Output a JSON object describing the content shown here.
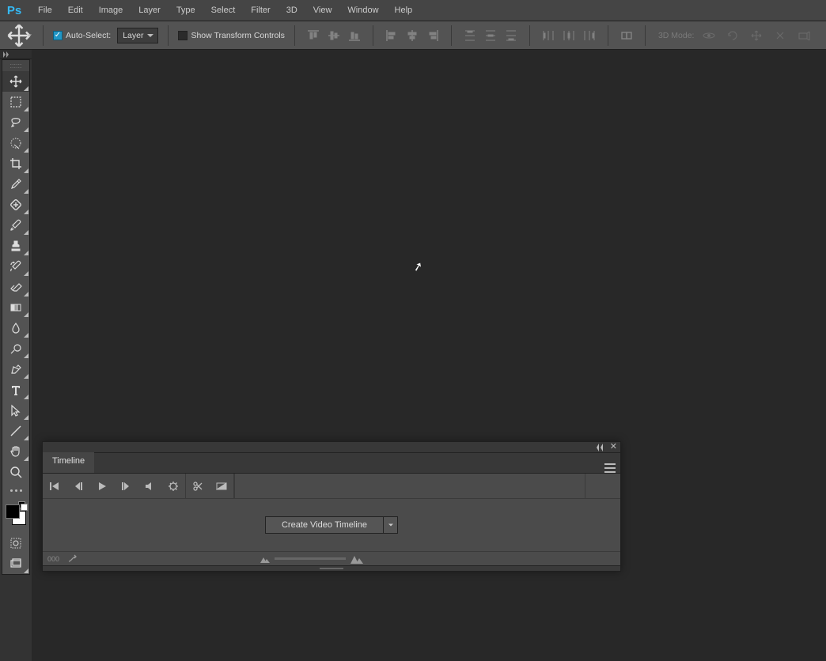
{
  "app_logo": "Ps",
  "menu": {
    "file": "File",
    "edit": "Edit",
    "image": "Image",
    "layer": "Layer",
    "type": "Type",
    "select": "Select",
    "filter": "Filter",
    "d3": "3D",
    "view": "View",
    "window": "Window",
    "help": "Help"
  },
  "options": {
    "auto_select_label": "Auto-Select:",
    "auto_select_checked": true,
    "target_value": "Layer",
    "show_transform_label": "Show Transform Controls",
    "show_transform_checked": false,
    "mode3d_label": "3D Mode:"
  },
  "timeline": {
    "title": "Timeline",
    "create_label": "Create Video Timeline",
    "frame_counter": "000"
  }
}
